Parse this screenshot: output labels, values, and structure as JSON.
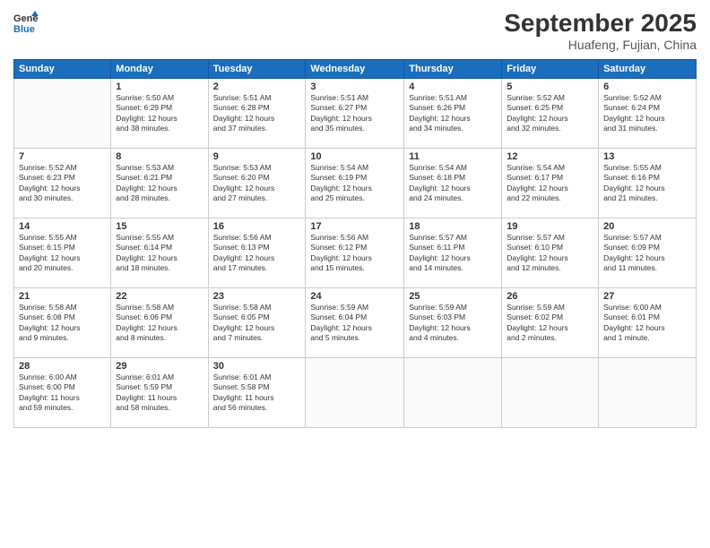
{
  "header": {
    "logo": {
      "general": "General",
      "blue": "Blue"
    },
    "month": "September 2025",
    "location": "Huafeng, Fujian, China"
  },
  "weekdays": [
    "Sunday",
    "Monday",
    "Tuesday",
    "Wednesday",
    "Thursday",
    "Friday",
    "Saturday"
  ],
  "weeks": [
    [
      {
        "day": "",
        "info": ""
      },
      {
        "day": "1",
        "info": "Sunrise: 5:50 AM\nSunset: 6:29 PM\nDaylight: 12 hours\nand 38 minutes."
      },
      {
        "day": "2",
        "info": "Sunrise: 5:51 AM\nSunset: 6:28 PM\nDaylight: 12 hours\nand 37 minutes."
      },
      {
        "day": "3",
        "info": "Sunrise: 5:51 AM\nSunset: 6:27 PM\nDaylight: 12 hours\nand 35 minutes."
      },
      {
        "day": "4",
        "info": "Sunrise: 5:51 AM\nSunset: 6:26 PM\nDaylight: 12 hours\nand 34 minutes."
      },
      {
        "day": "5",
        "info": "Sunrise: 5:52 AM\nSunset: 6:25 PM\nDaylight: 12 hours\nand 32 minutes."
      },
      {
        "day": "6",
        "info": "Sunrise: 5:52 AM\nSunset: 6:24 PM\nDaylight: 12 hours\nand 31 minutes."
      }
    ],
    [
      {
        "day": "7",
        "info": "Sunrise: 5:52 AM\nSunset: 6:23 PM\nDaylight: 12 hours\nand 30 minutes."
      },
      {
        "day": "8",
        "info": "Sunrise: 5:53 AM\nSunset: 6:21 PM\nDaylight: 12 hours\nand 28 minutes."
      },
      {
        "day": "9",
        "info": "Sunrise: 5:53 AM\nSunset: 6:20 PM\nDaylight: 12 hours\nand 27 minutes."
      },
      {
        "day": "10",
        "info": "Sunrise: 5:54 AM\nSunset: 6:19 PM\nDaylight: 12 hours\nand 25 minutes."
      },
      {
        "day": "11",
        "info": "Sunrise: 5:54 AM\nSunset: 6:18 PM\nDaylight: 12 hours\nand 24 minutes."
      },
      {
        "day": "12",
        "info": "Sunrise: 5:54 AM\nSunset: 6:17 PM\nDaylight: 12 hours\nand 22 minutes."
      },
      {
        "day": "13",
        "info": "Sunrise: 5:55 AM\nSunset: 6:16 PM\nDaylight: 12 hours\nand 21 minutes."
      }
    ],
    [
      {
        "day": "14",
        "info": "Sunrise: 5:55 AM\nSunset: 6:15 PM\nDaylight: 12 hours\nand 20 minutes."
      },
      {
        "day": "15",
        "info": "Sunrise: 5:55 AM\nSunset: 6:14 PM\nDaylight: 12 hours\nand 18 minutes."
      },
      {
        "day": "16",
        "info": "Sunrise: 5:56 AM\nSunset: 6:13 PM\nDaylight: 12 hours\nand 17 minutes."
      },
      {
        "day": "17",
        "info": "Sunrise: 5:56 AM\nSunset: 6:12 PM\nDaylight: 12 hours\nand 15 minutes."
      },
      {
        "day": "18",
        "info": "Sunrise: 5:57 AM\nSunset: 6:11 PM\nDaylight: 12 hours\nand 14 minutes."
      },
      {
        "day": "19",
        "info": "Sunrise: 5:57 AM\nSunset: 6:10 PM\nDaylight: 12 hours\nand 12 minutes."
      },
      {
        "day": "20",
        "info": "Sunrise: 5:57 AM\nSunset: 6:09 PM\nDaylight: 12 hours\nand 11 minutes."
      }
    ],
    [
      {
        "day": "21",
        "info": "Sunrise: 5:58 AM\nSunset: 6:08 PM\nDaylight: 12 hours\nand 9 minutes."
      },
      {
        "day": "22",
        "info": "Sunrise: 5:58 AM\nSunset: 6:06 PM\nDaylight: 12 hours\nand 8 minutes."
      },
      {
        "day": "23",
        "info": "Sunrise: 5:58 AM\nSunset: 6:05 PM\nDaylight: 12 hours\nand 7 minutes."
      },
      {
        "day": "24",
        "info": "Sunrise: 5:59 AM\nSunset: 6:04 PM\nDaylight: 12 hours\nand 5 minutes."
      },
      {
        "day": "25",
        "info": "Sunrise: 5:59 AM\nSunset: 6:03 PM\nDaylight: 12 hours\nand 4 minutes."
      },
      {
        "day": "26",
        "info": "Sunrise: 5:59 AM\nSunset: 6:02 PM\nDaylight: 12 hours\nand 2 minutes."
      },
      {
        "day": "27",
        "info": "Sunrise: 6:00 AM\nSunset: 6:01 PM\nDaylight: 12 hours\nand 1 minute."
      }
    ],
    [
      {
        "day": "28",
        "info": "Sunrise: 6:00 AM\nSunset: 6:00 PM\nDaylight: 11 hours\nand 59 minutes."
      },
      {
        "day": "29",
        "info": "Sunrise: 6:01 AM\nSunset: 5:59 PM\nDaylight: 11 hours\nand 58 minutes."
      },
      {
        "day": "30",
        "info": "Sunrise: 6:01 AM\nSunset: 5:58 PM\nDaylight: 11 hours\nand 56 minutes."
      },
      {
        "day": "",
        "info": ""
      },
      {
        "day": "",
        "info": ""
      },
      {
        "day": "",
        "info": ""
      },
      {
        "day": "",
        "info": ""
      }
    ]
  ]
}
